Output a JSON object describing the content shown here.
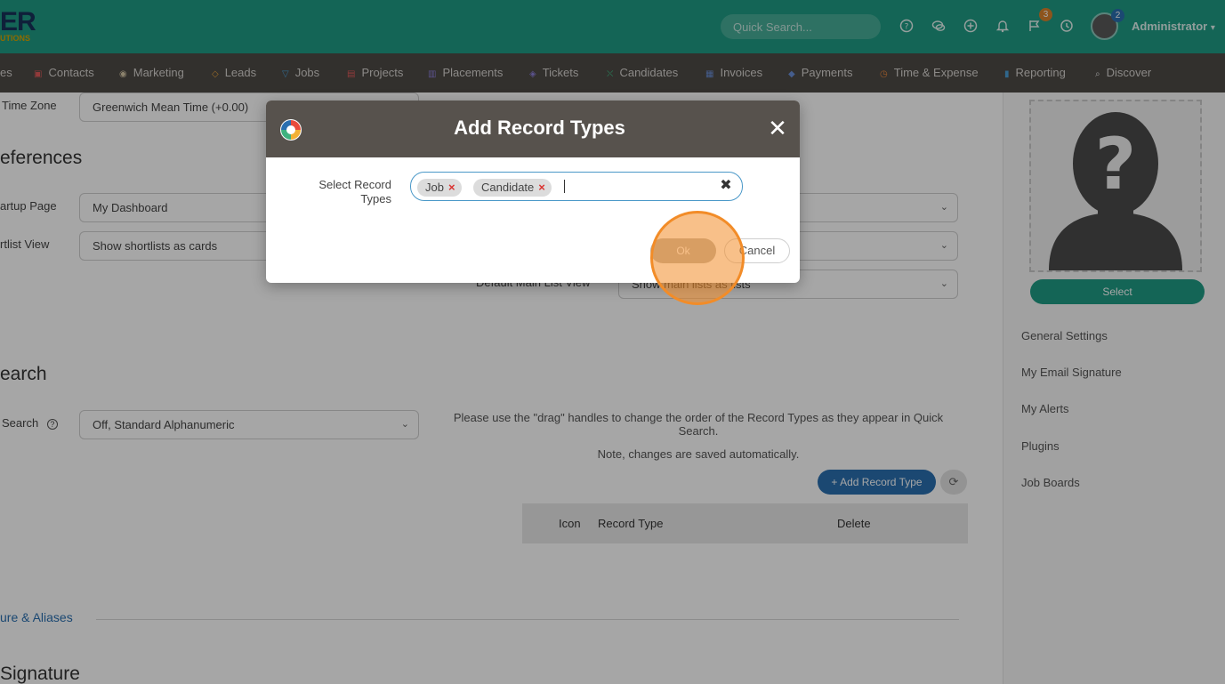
{
  "header": {
    "logo_text": "ER",
    "logo_sub": "UTIONS",
    "search_placeholder": "Quick Search...",
    "icons": [
      "help-circle-icon",
      "chat-bubbles-icon",
      "plus-circle-icon",
      "bell-icon",
      "flag-icon",
      "history-icon"
    ],
    "flag_badge": "3",
    "avatar_badge": "2",
    "user_name": "Administrator",
    "caret": "▾",
    "colors": {
      "topbar": "#1f9c84",
      "navbar": "#4e4a46",
      "accent_blue": "#2a6fb0",
      "badge_orange": "#d9822b"
    }
  },
  "nav": {
    "items": [
      {
        "label": "es",
        "icon": ""
      },
      {
        "label": "Contacts",
        "icon": "contacts-icon"
      },
      {
        "label": "Marketing",
        "icon": "broadcast-icon"
      },
      {
        "label": "Leads",
        "icon": "diamond-icon"
      },
      {
        "label": "Jobs",
        "icon": "trophy-icon"
      },
      {
        "label": "Projects",
        "icon": "clipboard-icon"
      },
      {
        "label": "Placements",
        "icon": "building-icon"
      },
      {
        "label": "Tickets",
        "icon": "ticket-icon"
      },
      {
        "label": "Candidates",
        "icon": "person-icon"
      },
      {
        "label": "Invoices",
        "icon": "invoice-icon"
      },
      {
        "label": "Payments",
        "icon": "payment-icon"
      },
      {
        "label": "Time & Expense",
        "icon": "clock-icon"
      },
      {
        "label": "Reporting",
        "icon": "bar-chart-icon"
      },
      {
        "label": "Discover",
        "icon": "search-icon"
      }
    ]
  },
  "page": {
    "time_zone_label": "Time Zone",
    "time_zone_value": "Greenwich Mean Time (+0.00)",
    "preferences_heading": "eferences",
    "startup_label": "artup Page",
    "startup_value": "My Dashboard",
    "shortlist_label": "rtlist View",
    "shortlist_value": "Show shortlists as cards",
    "default_main_list_label": "Default Main List View",
    "default_main_list_value": "Show main lists as lists",
    "search_heading": "earch",
    "search_label": "Search",
    "search_help_icon": "?",
    "search_value": "Off, Standard Alphanumeric",
    "drag_note": "Please use the \"drag\" handles to change the order of the Record Types as they appear in Quick Search.",
    "auto_save_note": "Note, changes are saved automatically.",
    "add_record_type_label": "+ Add Record Type",
    "refresh_icon": "⟳",
    "table_headers": [
      "Icon",
      "Record Type",
      "Delete"
    ],
    "signature_link": "ure & Aliases",
    "signature_heading": "Signature"
  },
  "right_panel": {
    "select_label": "Select",
    "links": [
      "General Settings",
      "My Email Signature",
      "My Alerts",
      "Plugins",
      "Job Boards"
    ]
  },
  "modal": {
    "title": "Add Record Types",
    "close": "✕",
    "field_label": "Select Record Types",
    "tags": [
      "Job",
      "Candidate"
    ],
    "tag_remove": "×",
    "clear": "✖",
    "ok_label": "Ok",
    "cancel_label": "Cancel"
  }
}
